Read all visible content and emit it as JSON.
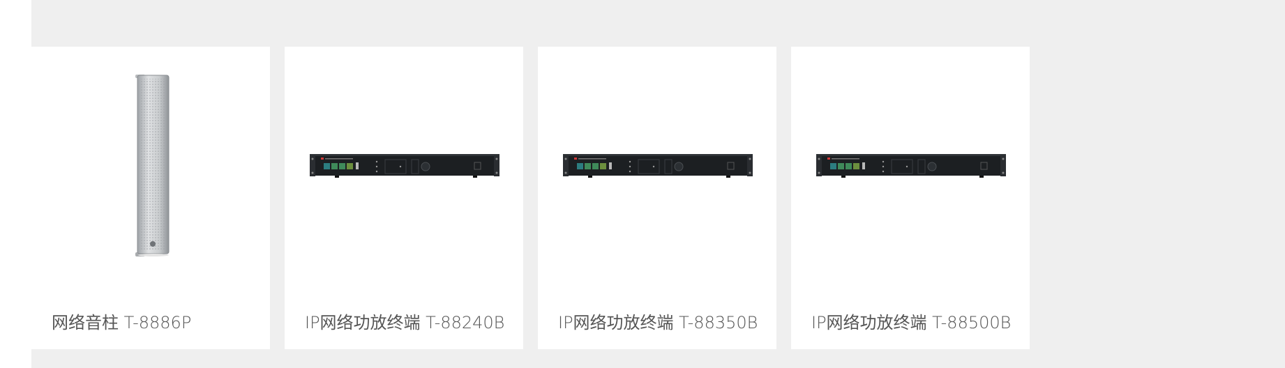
{
  "products": [
    {
      "name": "网络音柱 T-8886P",
      "image": "column-speaker-image"
    },
    {
      "name": "IP网络功放终端 T-88240B",
      "image": "rack-amplifier-image"
    },
    {
      "name": "IP网络功放终端 T-88350B",
      "image": "rack-amplifier-image"
    },
    {
      "name": "IP网络功放终端 T-88500B",
      "image": "rack-amplifier-image"
    }
  ],
  "colors": {
    "page_background": "#efefef",
    "card_background": "#ffffff",
    "product_name_text": "#555555"
  }
}
